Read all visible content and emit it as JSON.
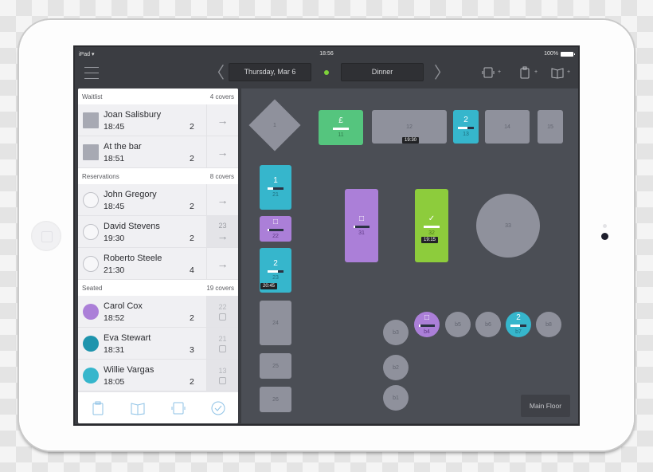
{
  "status_bar": {
    "carrier": "iPad",
    "time": "18:56",
    "battery": "100%"
  },
  "toolbar": {
    "date": "Thursday, Mar 6",
    "shift": "Dinner",
    "live_color": "#7ed23a",
    "actions": [
      {
        "icon": "table-add-icon",
        "label": "+"
      },
      {
        "icon": "waitlist-add-icon",
        "label": "+"
      },
      {
        "icon": "reservation-add-icon",
        "label": "+"
      }
    ]
  },
  "list": {
    "sections": [
      {
        "title": "Waitlist",
        "covers": "4 covers",
        "rows": [
          {
            "name": "Joan Salisbury",
            "time": "18:45",
            "covers": "2",
            "avatar": "clipboard"
          },
          {
            "name": "At the bar",
            "time": "18:51",
            "covers": "2",
            "avatar": "clipboard"
          }
        ]
      },
      {
        "title": "Reservations",
        "covers": "8 covers",
        "rows": [
          {
            "name": "John Gregory",
            "time": "18:45",
            "covers": "2",
            "avatar": "book"
          },
          {
            "name": "David Stevens",
            "time": "19:30",
            "covers": "2",
            "avatar": "book",
            "table": "23"
          },
          {
            "name": "Roberto Steele",
            "time": "21:30",
            "covers": "4",
            "avatar": "book"
          }
        ]
      },
      {
        "title": "Seated",
        "covers": "19 covers",
        "rows": [
          {
            "name": "Carol Cox",
            "time": "18:52",
            "covers": "2",
            "avatar": "seated",
            "color": "#ab7fd8",
            "table": "22"
          },
          {
            "name": "Eva Stewart",
            "time": "18:31",
            "covers": "3",
            "avatar": "course-1",
            "color": "#1e94ad",
            "table": "21"
          },
          {
            "name": "Willie Vargas",
            "time": "18:05",
            "covers": "2",
            "avatar": "course-2",
            "color": "#36b6cc",
            "table": "13"
          }
        ]
      }
    ],
    "footer_tabs": [
      "waitlist-tab",
      "reservations-tab",
      "tables-tab",
      "finished-tab"
    ]
  },
  "floor": {
    "name": "Main Floor",
    "tables": [
      {
        "id": "1",
        "status": "empty"
      },
      {
        "id": "11",
        "status": "paid",
        "icon": "£",
        "progress": 1.0
      },
      {
        "id": "12",
        "status": "empty",
        "tag": "19:30"
      },
      {
        "id": "13",
        "status": "course-2",
        "icon": "2",
        "progress": 0.6
      },
      {
        "id": "14",
        "status": "empty"
      },
      {
        "id": "15",
        "status": "empty"
      },
      {
        "id": "21",
        "status": "course-1",
        "icon": "1",
        "progress": 0.35
      },
      {
        "id": "22",
        "status": "seated",
        "icon": "□",
        "progress": 0.0
      },
      {
        "id": "23",
        "status": "course-2",
        "icon": "2",
        "progress": 0.65,
        "tag": "20:45"
      },
      {
        "id": "24",
        "status": "empty"
      },
      {
        "id": "25",
        "status": "empty"
      },
      {
        "id": "26",
        "status": "empty"
      },
      {
        "id": "31",
        "status": "seated",
        "icon": "□",
        "progress": 0.1
      },
      {
        "id": "32",
        "status": "finished",
        "icon": "✓",
        "progress": 1.0,
        "tag": "19:15"
      },
      {
        "id": "33",
        "status": "empty"
      },
      {
        "id": "b1",
        "status": "empty"
      },
      {
        "id": "b2",
        "status": "empty"
      },
      {
        "id": "b3",
        "status": "empty"
      },
      {
        "id": "b4",
        "status": "seated",
        "icon": "□",
        "progress": 0.1
      },
      {
        "id": "b5",
        "status": "empty"
      },
      {
        "id": "b6",
        "status": "empty"
      },
      {
        "id": "b7",
        "status": "course-2",
        "icon": "2",
        "progress": 0.6
      },
      {
        "id": "b8",
        "status": "empty"
      }
    ]
  }
}
